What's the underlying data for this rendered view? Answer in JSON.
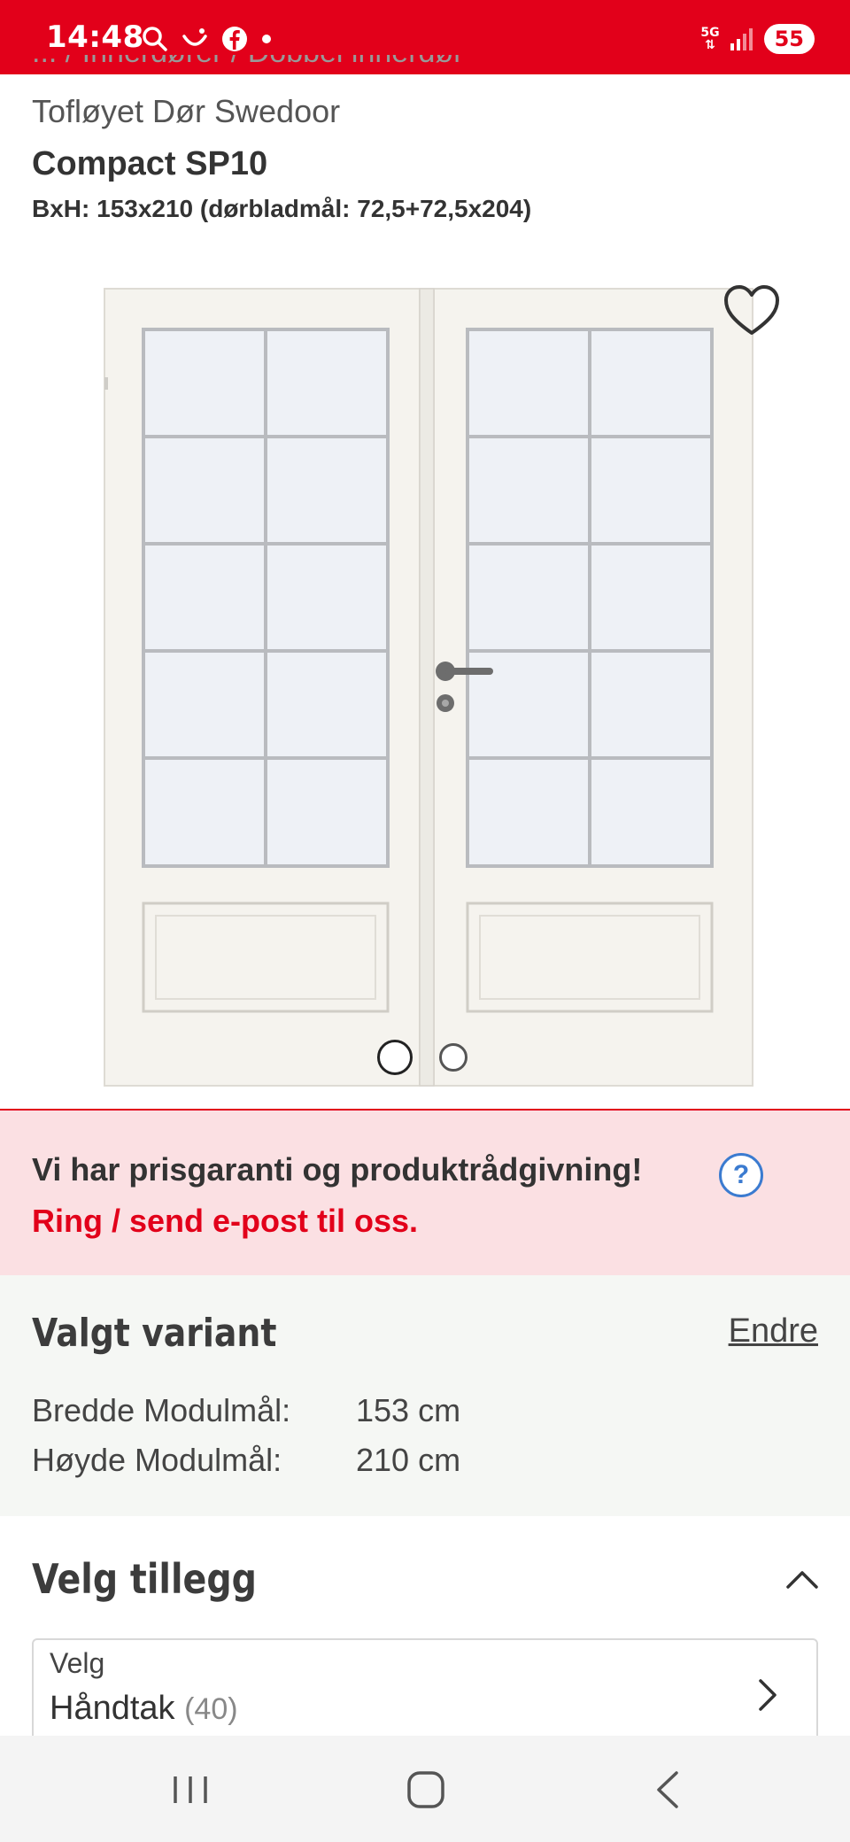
{
  "status_bar": {
    "time": "14:48",
    "network": "5G",
    "battery": "55",
    "colors": {
      "background": "#e2001a"
    },
    "icons": [
      "search-icon",
      "smile-icon",
      "facebook-icon",
      "notification-dot-icon",
      "signal-icon"
    ]
  },
  "header": {
    "breadcrumb": "... / Innerdører / Dobbel innerdør",
    "subtitle": "Tofløyet Dør Swedoor",
    "title": "Compact SP10",
    "dimensions": "BxH: 153x210 (dørbladmål: 72,5+72,5x204)"
  },
  "gallery": {
    "current_image": 1,
    "image_count": 2,
    "favorite_icon": "heart-icon"
  },
  "banner": {
    "line1": "Vi har prisgaranti og produktrådgivning!",
    "line2": "Ring / send e-post til oss.",
    "help_symbol": "?",
    "colors": {
      "background": "#fbe0e3",
      "accent": "#e2001a",
      "help": "#3b7bd0"
    }
  },
  "variant": {
    "title": "Valgt variant",
    "change_label": "Endre",
    "rows": [
      {
        "label": "Bredde Modulmål:",
        "value": "153 cm"
      },
      {
        "label": "Høyde Modulmål:",
        "value": "210 cm"
      }
    ]
  },
  "addons": {
    "title": "Velg tillegg",
    "select_label": "Velg",
    "select_value": "Håndtak",
    "select_count": "(40)"
  },
  "nav": {
    "icons": [
      "recents-icon",
      "home-icon",
      "back-icon"
    ]
  }
}
